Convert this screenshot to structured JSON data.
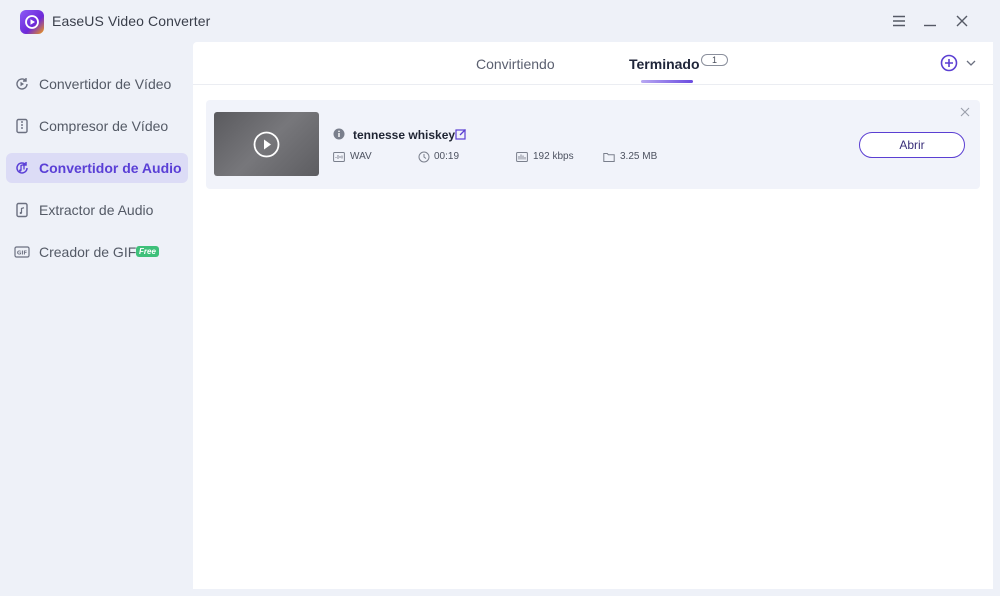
{
  "app": {
    "title": "EaseUS Video Converter"
  },
  "sidebar": {
    "items": [
      {
        "label": "Convertidor de Vídeo",
        "icon": "video-convert-icon"
      },
      {
        "label": "Compresor de Vídeo",
        "icon": "compress-icon"
      },
      {
        "label": "Convertidor de Audio",
        "icon": "audio-convert-icon",
        "active": true
      },
      {
        "label": "Extractor de Audio",
        "icon": "audio-extract-icon"
      },
      {
        "label": "Creador de GIF",
        "icon": "gif-icon",
        "badge": "Free"
      }
    ]
  },
  "tabs": {
    "converting": "Convirtiendo",
    "finished": "Terminado",
    "finished_count": "1"
  },
  "task": {
    "name": "tennesse whiskey",
    "format": "WAV",
    "duration": "00:19",
    "bitrate": "192 kbps",
    "size": "3.25 MB",
    "open_label": "Abrir"
  },
  "colors": {
    "accent": "#5b3fd2",
    "active_bg": "#dcdcf6",
    "badge": "#3ec07a"
  }
}
